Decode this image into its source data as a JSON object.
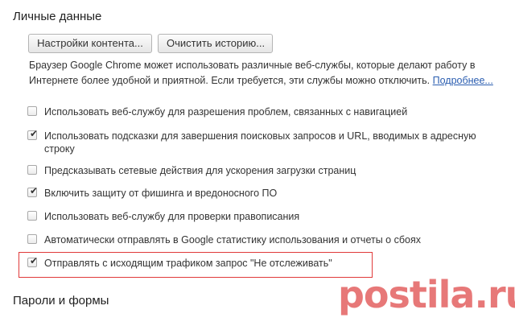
{
  "personal": {
    "title": "Личные данные",
    "btn_content": "Настройки контента...",
    "btn_clear": "Очистить историю...",
    "description": "Браузер Google Chrome может использовать различные веб-службы, которые делают работу в Интернете более удобной и приятной. Если требуется, эти службы можно отключить. ",
    "learn_more": "Подробнее..."
  },
  "options": [
    {
      "label": "Использовать веб-службу для разрешения проблем, связанных с навигацией",
      "checked": false
    },
    {
      "label": "Использовать подсказки для завершения поисковых запросов и URL, вводимых в адресную строку",
      "checked": true
    },
    {
      "label": "Предсказывать сетевые действия для ускорения загрузки страниц",
      "checked": false
    },
    {
      "label": "Включить защиту от фишинга и вредоносного ПО",
      "checked": true
    },
    {
      "label": "Использовать веб-службу для проверки правописания",
      "checked": false
    },
    {
      "label": "Автоматически отправлять в Google статистику использования и отчеты о сбоях",
      "checked": false
    },
    {
      "label": "Отправлять с исходящим трафиком запрос \"Не отслеживать\"",
      "checked": true
    }
  ],
  "passwords": {
    "title": "Пароли и формы"
  },
  "watermark": "postila.ru",
  "colors": {
    "highlight": "#e03a3a",
    "link": "#2a5db0",
    "watermark": "#e56a6a"
  }
}
